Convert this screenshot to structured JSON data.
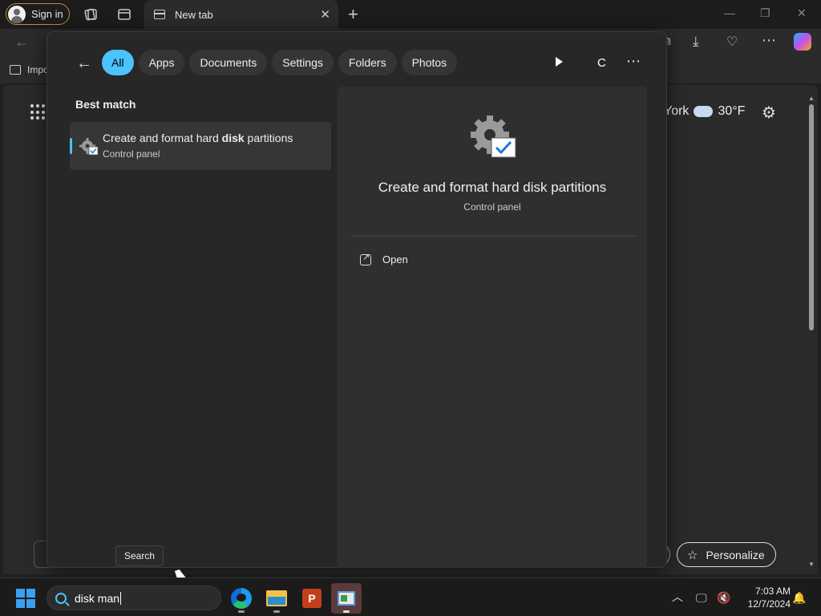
{
  "browser": {
    "signin_label": "Sign in",
    "tab_title": "New tab",
    "bookmark_label": "Impo"
  },
  "newtab_page": {
    "weather_city": "York",
    "weather_temp": "30°F",
    "personalize_label": "Personalize"
  },
  "search_panel": {
    "filters": [
      "All",
      "Apps",
      "Documents",
      "Settings",
      "Folders",
      "Photos"
    ],
    "active_filter": "All",
    "user_initial": "C",
    "best_match_heading": "Best match",
    "result": {
      "title_before": "Create and format hard ",
      "title_bold": "disk",
      "title_after": " partitions",
      "subtitle": "Control panel"
    },
    "detail": {
      "title": "Create and format hard disk partitions",
      "subtitle": "Control panel",
      "actions": [
        {
          "label": "Open",
          "icon": "open-external-icon"
        }
      ]
    }
  },
  "tooltip": "Search",
  "taskbar": {
    "search_value": "disk man",
    "apps": [
      "edge-icon",
      "file-explorer-icon",
      "powerpoint-icon",
      "control-panel-icon"
    ],
    "time": "7:03 AM",
    "date": "12/7/2024"
  },
  "colors": {
    "accent": "#4cc2ff",
    "panel_bg": "#272727",
    "signin_border": "#c88a3a"
  }
}
